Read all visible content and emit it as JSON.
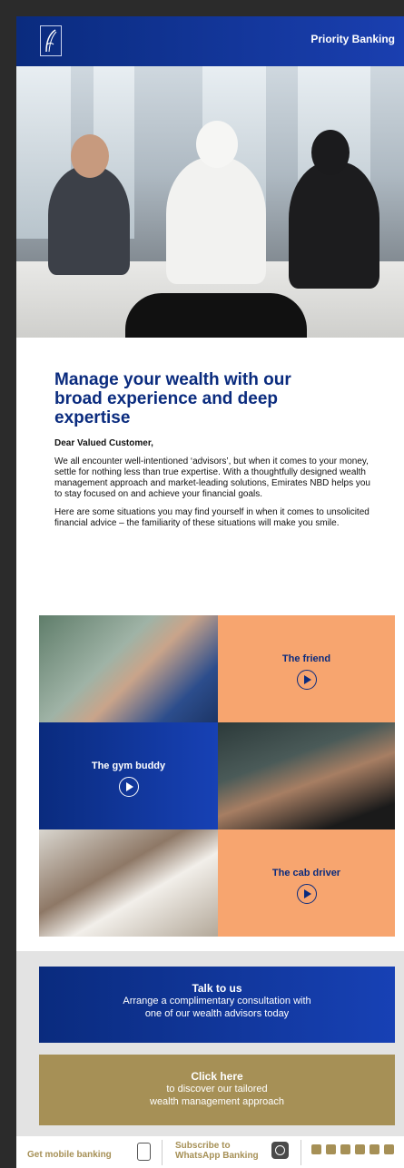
{
  "header": {
    "title": "Priority Banking",
    "logo": "emirates-nbd-logo"
  },
  "article": {
    "title": "Manage your wealth with our broad experience and deep expertise",
    "greeting": "Dear Valued Customer,",
    "paragraphs": [
      "We all encounter well-intentioned ‘advisors’, but when it comes to your money, settle for nothing less than true expertise. With a thoughtfully designed wealth management approach and market-leading solutions, Emirates NBD helps you to stay focused on and achieve your financial goals.",
      "Here are some situations you may find yourself in when it comes to unsolicited financial advice – the familiarity of these situations will make you smile."
    ]
  },
  "videos": [
    {
      "label": "The friend"
    },
    {
      "label": "The gym buddy"
    },
    {
      "label": "The cab driver"
    }
  ],
  "cta": {
    "talk": {
      "title": "Talk to us",
      "line1": "Arrange a complimentary consultation with",
      "line2": "one of our wealth advisors today"
    },
    "click": {
      "title": "Click here",
      "line1": "to discover our tailored",
      "line2": "wealth management approach"
    }
  },
  "footer": {
    "mobile": "Get mobile banking",
    "whatsapp_line1": "Subscribe to",
    "whatsapp_line2": "WhatsApp Banking",
    "social_icons": [
      "twitter-icon",
      "linkedin-icon",
      "youtube-icon",
      "facebook-icon",
      "square-icon",
      "instagram-icon"
    ]
  },
  "colors": {
    "navy": "#0a2b7e",
    "orange": "#f7a56f",
    "gold": "#a69056"
  }
}
